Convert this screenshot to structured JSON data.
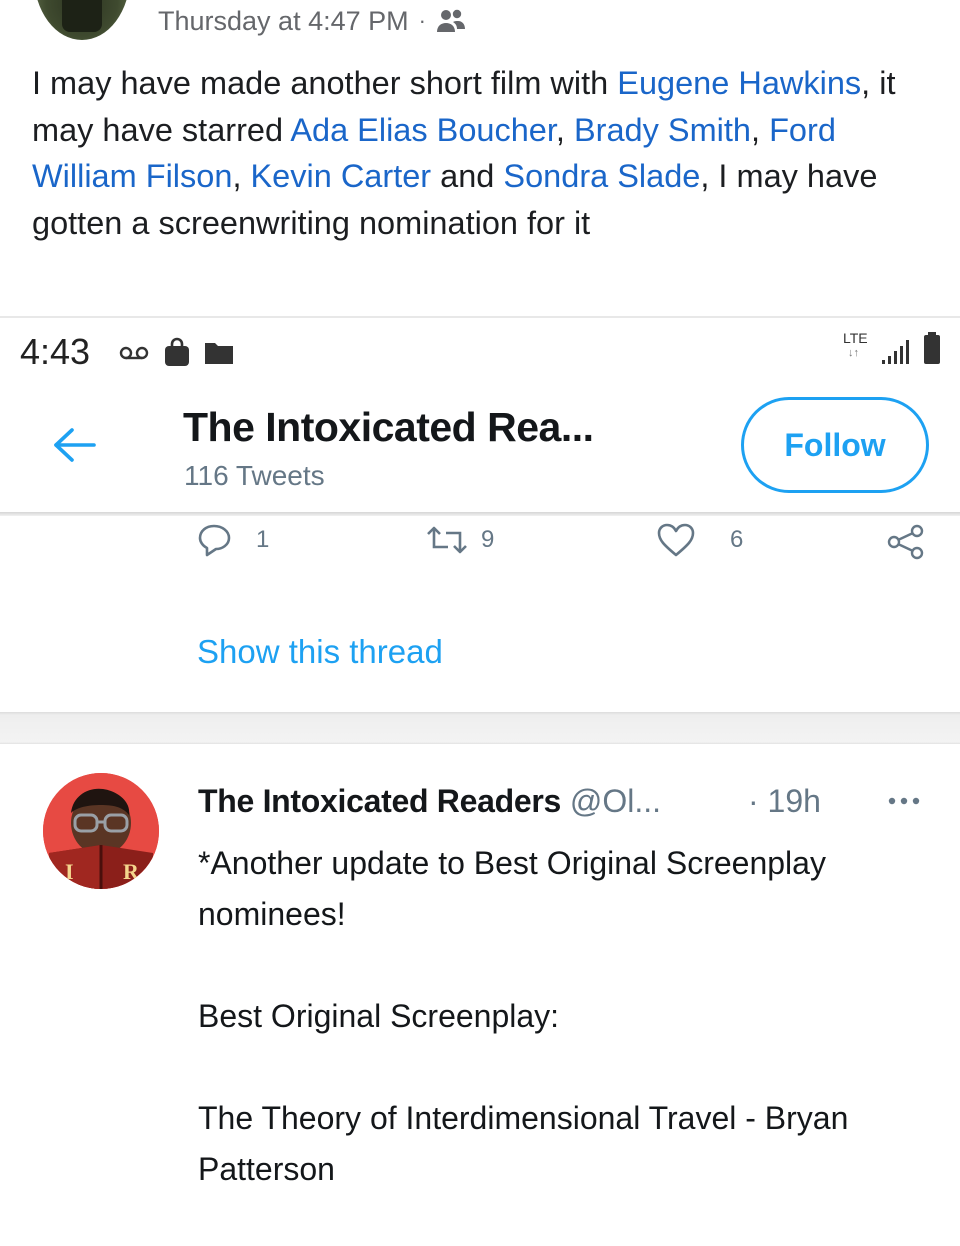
{
  "post": {
    "timestamp": "Thursday at 4:47 PM",
    "separator": "·",
    "audience_icon": "friends-icon",
    "text_segments": [
      {
        "text": "I may have made another short film with ",
        "tag": false
      },
      {
        "text": "Eugene Hawkins",
        "tag": true
      },
      {
        "text": ", it may have starred ",
        "tag": false
      },
      {
        "text": "Ada Elias Boucher",
        "tag": true
      },
      {
        "text": ", ",
        "tag": false
      },
      {
        "text": "Brady Smith",
        "tag": true
      },
      {
        "text": ", ",
        "tag": false
      },
      {
        "text": "Ford William Filson",
        "tag": true
      },
      {
        "text": ", ",
        "tag": false
      },
      {
        "text": "Kevin Carter",
        "tag": true
      },
      {
        "text": " and ",
        "tag": false
      },
      {
        "text": "Sondra Slade",
        "tag": true
      },
      {
        "text": ", I may have gotten a screenwriting nomination for it",
        "tag": false
      }
    ]
  },
  "screenshot": {
    "status_bar": {
      "time": "4:43",
      "network": "LTE"
    },
    "profile_header": {
      "title": "The Intoxicated Rea...",
      "tweet_count": "116 Tweets",
      "follow_label": "Follow"
    },
    "tweet_actions": {
      "replies": "1",
      "retweets": "9",
      "likes": "6"
    },
    "show_thread": "Show this thread",
    "tweet": {
      "name": "The Intoxicated Readers",
      "handle": "@Ol...",
      "time": "· 19h",
      "avatar_letters": [
        "I",
        "R"
      ],
      "paragraphs": [
        "*Another update to Best Original Screenplay nominees!",
        "Best Original Screenplay:",
        "The Theory of Interdimensional Travel - Bryan Patterson"
      ]
    }
  },
  "colors": {
    "facebook_link": "#1a66c9",
    "twitter_blue": "#1da1f2",
    "twitter_gray": "#657786",
    "avatar_red": "#e74a43"
  }
}
